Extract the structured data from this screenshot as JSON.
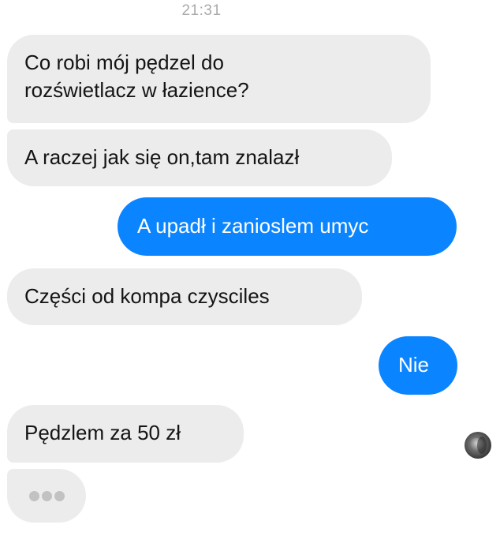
{
  "timestamp": "21:31",
  "messages": [
    {
      "direction": "incoming",
      "lines": [
        "Co robi mój pędzel do",
        "rozświetlacz w łazience?"
      ]
    },
    {
      "direction": "incoming",
      "text": "A raczej jak się on,tam znalazł"
    },
    {
      "direction": "outgoing",
      "text": "A upadł i zanioslem umyc"
    },
    {
      "direction": "incoming",
      "text": "Części od kompa czysciles"
    },
    {
      "direction": "outgoing",
      "text": "Nie"
    },
    {
      "direction": "incoming",
      "text": "Pędzlem za 50 zł"
    }
  ],
  "typing_indicator": {
    "dots": 3
  },
  "seen_avatar": {
    "icon": "user-avatar-icon"
  },
  "colors": {
    "incoming_bubble": "#ececec",
    "outgoing_bubble": "#0b85ff",
    "timestamp_text": "#a9a9a9",
    "typing_dot": "#c2c2c2"
  }
}
